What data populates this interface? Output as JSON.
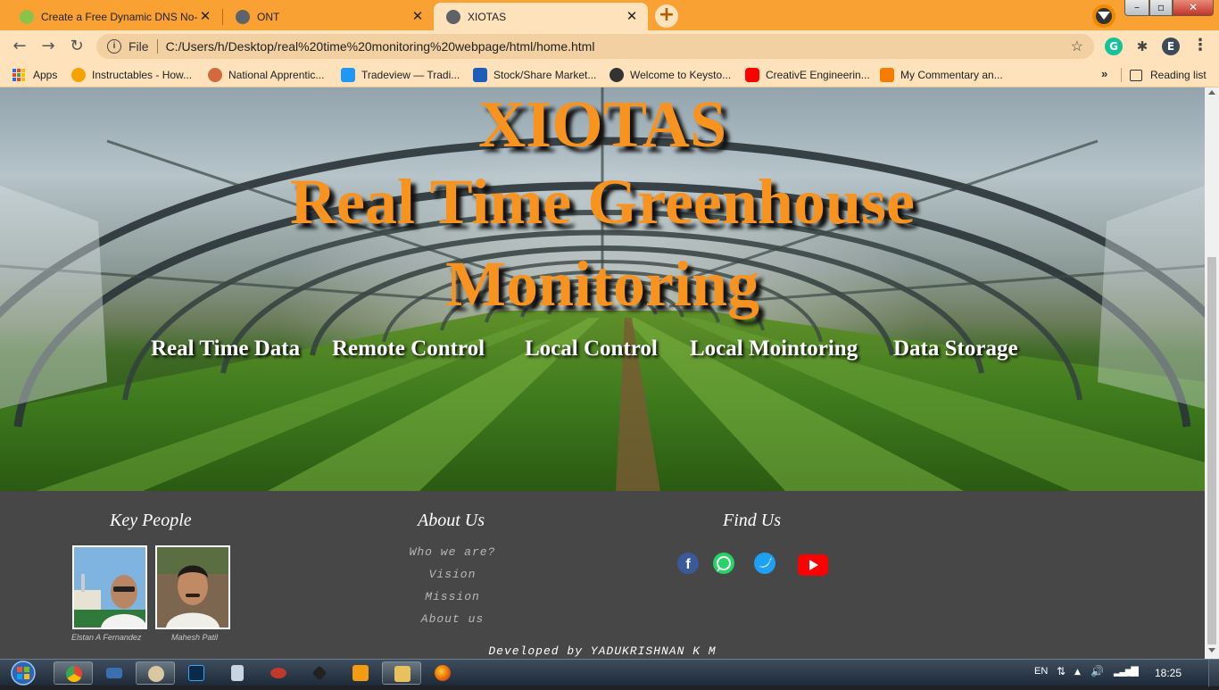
{
  "browser": {
    "tabs": [
      {
        "title": "Create a Free Dynamic DNS No-I",
        "state": "inactive",
        "favicon_color": "#8bc34a"
      },
      {
        "title": "ONT",
        "state": "inactive",
        "favicon_color": "#5f6368"
      },
      {
        "title": "XIOTAS",
        "state": "active",
        "favicon_color": "#5f6368"
      }
    ],
    "new_tab_label": "+",
    "address": {
      "scheme_label": "File",
      "url": "C:/Users/h/Desktop/real%20time%20monitoring%20webpage/html/home.html"
    },
    "profile_initial": "E",
    "grammarly_initial": "G",
    "bookmarks": [
      {
        "label": "Apps",
        "icon": "apps-grid-icon"
      },
      {
        "label": "Instructables - How...",
        "icon": "instructables-icon",
        "color": "#f4a300"
      },
      {
        "label": "National Apprentic...",
        "icon": "apprentice-icon",
        "color": "#d36a3e"
      },
      {
        "label": "Tradeview — Tradi...",
        "icon": "tradeview-icon",
        "color": "#2196f3"
      },
      {
        "label": "Stock/Share Market...",
        "icon": "stock-market-icon",
        "color": "#1e5eb8"
      },
      {
        "label": "Welcome to Keysto...",
        "icon": "globe-icon",
        "color": "#333333"
      },
      {
        "label": "CreativE Engineerin...",
        "icon": "youtube-icon",
        "color": "#ff0000"
      },
      {
        "label": "My Commentary an...",
        "icon": "blogger-icon",
        "color": "#f57c00"
      }
    ],
    "bookmarks_more": "»",
    "reading_list": "Reading list"
  },
  "page": {
    "brand": "XIOTAS",
    "title_line1": "Real Time Greenhouse",
    "title_line2": "Monitoring",
    "accent_color": "#f7931e",
    "nav": [
      "Real Time Data",
      "Remote Control",
      "Local Control",
      "Local Mointoring",
      "Data Storage"
    ],
    "footer": {
      "key_people_heading": "Key People",
      "people": [
        {
          "name": "Elstan A Fernandez"
        },
        {
          "name": "Mahesh Patil"
        }
      ],
      "about_heading": "About Us",
      "about_links": [
        "Who we are?",
        "Vision",
        "Mission",
        "About us"
      ],
      "find_heading": "Find Us",
      "social": [
        {
          "icon": "facebook-icon",
          "color": "#3b5998"
        },
        {
          "icon": "whatsapp-icon",
          "color": "#25d366"
        },
        {
          "icon": "twitter-icon",
          "color": "#1da1f2"
        },
        {
          "icon": "youtube-icon",
          "color": "#ff0000"
        }
      ],
      "developer_line": "Developed by YADUKRISHNAN K M",
      "background_color": "#474747"
    }
  },
  "taskbar": {
    "language": "EN",
    "time": "18:25",
    "apps": [
      "chrome-icon",
      "keyboard-icon",
      "paint-icon",
      "photoshop-icon",
      "calculator-icon",
      "eye-icon",
      "inkscape-icon",
      "media-player-icon",
      "explorer-icon",
      "firefox-icon"
    ]
  }
}
